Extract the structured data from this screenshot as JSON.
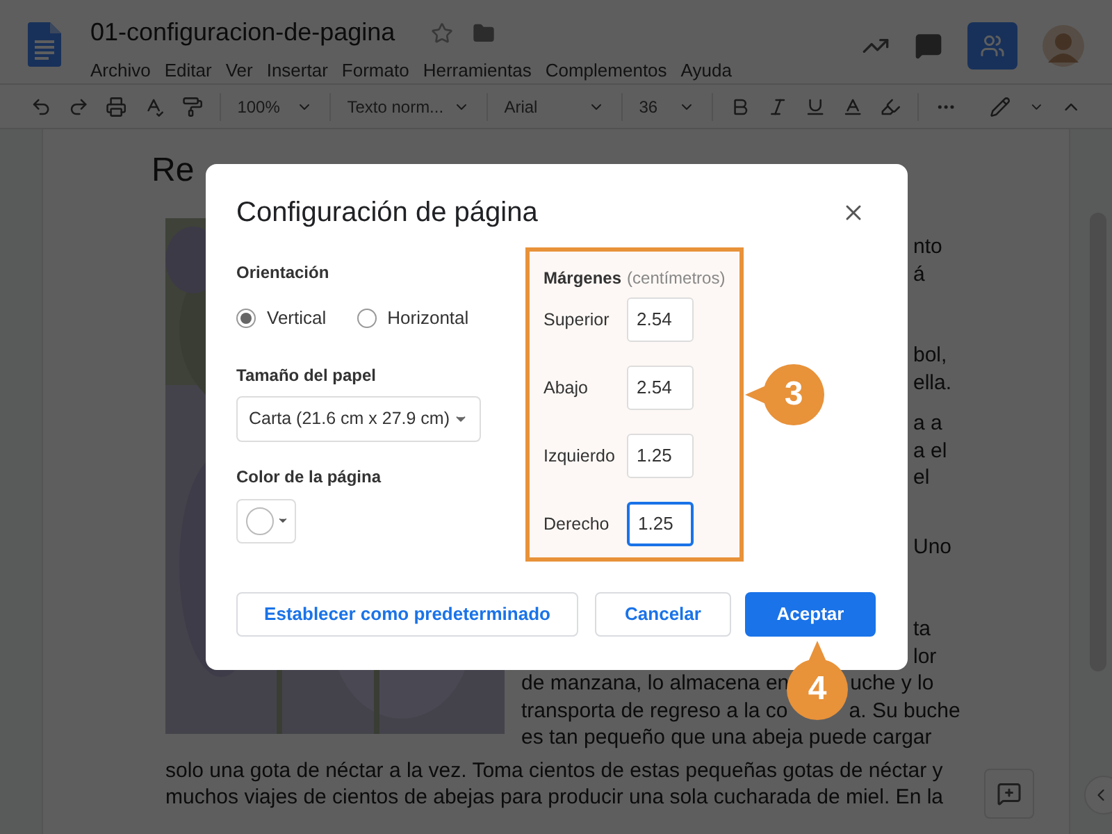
{
  "document": {
    "title": "01-configuracion-de-pagina",
    "menu": [
      "Archivo",
      "Editar",
      "Ver",
      "Insertar",
      "Formato",
      "Herramientas",
      "Complementos",
      "Ayuda"
    ]
  },
  "toolbar": {
    "dropdowns": [
      {
        "label": "100%",
        "kind": "zoom"
      },
      {
        "label": "Texto norm...",
        "kind": "style"
      },
      {
        "label": "Arial",
        "kind": "font"
      },
      {
        "label": "36",
        "kind": "size"
      }
    ]
  },
  "page": {
    "heading": "Re",
    "paragraphs": [
      [
        {
          "kind": "fragment",
          "text": "nto"
        },
        {
          "kind": "fragment",
          "text": "á"
        }
      ],
      [
        {
          "kind": "fragment",
          "text": "bol,"
        },
        {
          "kind": "fragment",
          "text": "ella."
        }
      ],
      [
        {
          "kind": "fragment",
          "text": "a a"
        },
        {
          "kind": "fragment",
          "text": "a el"
        },
        {
          "kind": "fragment",
          "text": "el"
        }
      ],
      [
        {
          "kind": "fragment",
          "text": "Uno"
        }
      ],
      [
        {
          "kind": "fragment",
          "text": "ta"
        },
        {
          "kind": "fragment",
          "text": "lor"
        },
        {
          "kind": "split",
          "parts": [
            "de manzana, lo almacena en",
            "uche y lo"
          ]
        },
        {
          "kind": "split",
          "parts": [
            "transporta de regreso a la co",
            "a. Su buche"
          ]
        },
        {
          "kind": "line",
          "text": "es tan pequeño que una abeja puede cargar"
        }
      ]
    ],
    "full_lines": [
      "solo una gota de néctar a la vez. Toma cientos de estas pequeñas gotas de néctar y",
      "muchos viajes de cientos de abejas para producir una sola cucharada de miel. En la"
    ]
  },
  "dialog": {
    "title": "Configuración de página",
    "orientation": {
      "label": "Orientación",
      "options": [
        {
          "label": "Vertical",
          "selected": true
        },
        {
          "label": "Horizontal",
          "selected": false
        }
      ]
    },
    "paper_size": {
      "label": "Tamaño del papel",
      "value": "Carta (21.6 cm x 27.9 cm)"
    },
    "page_color": {
      "label": "Color de la página",
      "color": "#ffffff"
    },
    "margins": {
      "label": "Márgenes",
      "unit": "(centímetros)",
      "fields": [
        {
          "label": "Superior",
          "value": "2.54",
          "focused": false
        },
        {
          "label": "Abajo",
          "value": "2.54",
          "focused": false
        },
        {
          "label": "Izquierdo",
          "value": "1.25",
          "focused": false
        },
        {
          "label": "Derecho",
          "value": "1.25",
          "focused": true
        }
      ]
    },
    "buttons": [
      {
        "label": "Establecer como predeterminado",
        "kind": "secondary"
      },
      {
        "label": "Cancelar",
        "kind": "secondary"
      },
      {
        "label": "Aceptar",
        "kind": "primary"
      }
    ]
  },
  "callouts": [
    {
      "number": "3",
      "kind": "left"
    },
    {
      "number": "4",
      "kind": "up"
    }
  ]
}
